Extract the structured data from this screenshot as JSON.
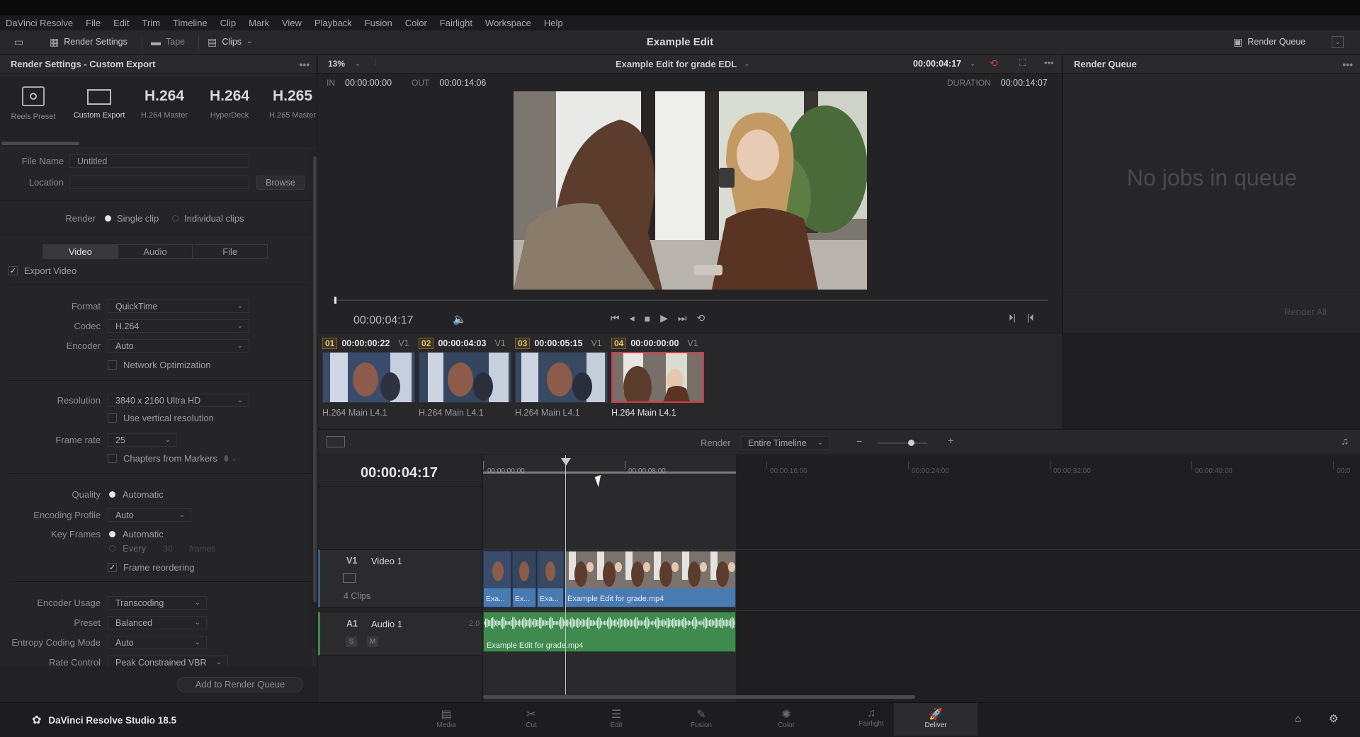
{
  "menubar": {
    "items": [
      "DaVinci Resolve",
      "File",
      "Edit",
      "Trim",
      "Timeline",
      "Clip",
      "Mark",
      "View",
      "Playback",
      "Fusion",
      "Color",
      "Fairlight",
      "Workspace",
      "Help"
    ]
  },
  "toolbar": {
    "render_settings": "Render Settings",
    "tape": "Tape",
    "clips": "Clips",
    "project_title": "Example Edit",
    "render_queue": "Render Queue"
  },
  "render_settings": {
    "title": "Render Settings - Custom Export",
    "presets": [
      {
        "big": "",
        "label": "Reels Preset"
      },
      {
        "big": "",
        "label": "Custom Export"
      },
      {
        "big": "H.264",
        "label": "H.264 Master"
      },
      {
        "big": "H.264",
        "label": "HyperDeck"
      },
      {
        "big": "H.265",
        "label": "H.265 Master"
      }
    ],
    "file_name_label": "File Name",
    "file_name_value": "Untitled",
    "location_label": "Location",
    "location_value": "",
    "browse": "Browse",
    "render_label": "Render",
    "single_clip": "Single clip",
    "individual_clips": "Individual clips",
    "tabs": [
      "Video",
      "Audio",
      "File"
    ],
    "export_video": "Export Video",
    "format_label": "Format",
    "format_value": "QuickTime",
    "codec_label": "Codec",
    "codec_value": "H.264",
    "encoder_label": "Encoder",
    "encoder_value": "Auto",
    "network_optimization": "Network Optimization",
    "resolution_label": "Resolution",
    "resolution_value": "3840 x 2160 Ultra HD",
    "use_vertical": "Use vertical resolution",
    "frame_rate_label": "Frame rate",
    "frame_rate_value": "25",
    "chapters": "Chapters from Markers",
    "quality_label": "Quality",
    "quality_value": "Automatic",
    "encoding_profile_label": "Encoding Profile",
    "encoding_profile_value": "Auto",
    "key_frames_label": "Key Frames",
    "key_frames_auto": "Automatic",
    "key_frames_every": "Every",
    "key_frames_num": "30",
    "key_frames_unit": "frames",
    "frame_reordering": "Frame reordering",
    "encoder_usage_label": "Encoder Usage",
    "encoder_usage_value": "Transcoding",
    "preset_label": "Preset",
    "preset_value": "Balanced",
    "entropy_label": "Entropy Coding Mode",
    "entropy_value": "Auto",
    "rate_control_label": "Rate Control",
    "rate_control_value": "Peak Constrained VBR",
    "add_to_queue": "Add to Render Queue"
  },
  "viewer": {
    "zoom": "13%",
    "timeline_name": "Example Edit for grade EDL",
    "timecode_top": "00:00:04:17",
    "in_label": "IN",
    "in_value": "00:00:00:00",
    "out_label": "OUT",
    "out_value": "00:00:14:06",
    "duration_label": "DURATION",
    "duration_value": "00:00:14:07",
    "timecode": "00:00:04:17",
    "scrub_position": 0.003
  },
  "clips": [
    {
      "num": "01",
      "tc": "00:00:00:22",
      "track": "V1",
      "codec": "H.264 Main L4.1",
      "selected": false
    },
    {
      "num": "02",
      "tc": "00:00:04:03",
      "track": "V1",
      "codec": "H.264 Main L4.1",
      "selected": false
    },
    {
      "num": "03",
      "tc": "00:00:05:15",
      "track": "V1",
      "codec": "H.264 Main L4.1",
      "selected": false
    },
    {
      "num": "04",
      "tc": "00:00:00:00",
      "track": "V1",
      "codec": "H.264 Main L4.1",
      "selected": true
    }
  ],
  "render_bar": {
    "render_label": "Render",
    "render_value": "Entire Timeline"
  },
  "timeline": {
    "timecode": "00:00:04:17",
    "ruler": [
      "00:00:00:00",
      "00:00:08:00",
      "00:00:16:00",
      "00:00:24:00",
      "00:00:32:00",
      "00:00:40:00",
      "00:0"
    ],
    "v1_label": "V1",
    "v1_name": "Video 1",
    "v1_count": "4 Clips",
    "a1_label": "A1",
    "a1_name": "Audio 1",
    "a1_channels": "2.0",
    "s": "S",
    "m": "M",
    "video_clips": [
      "Exa...",
      "Ex...",
      "Exa...",
      "Example Edit for grade.mp4"
    ],
    "audio_clip": "Example Edit for grade.mp4"
  },
  "render_queue": {
    "title": "Render Queue",
    "empty": "No jobs in queue",
    "render_all": "Render All"
  },
  "footer": {
    "app": "DaVinci Resolve Studio 18.5",
    "pages": [
      "Media",
      "Cut",
      "Edit",
      "Fusion",
      "Color",
      "Fairlight",
      "Deliver"
    ]
  },
  "colors": {
    "accent_red": "#d8384b",
    "clip_blue": "#4a7ab2",
    "audio_green": "#3f8a4f"
  }
}
